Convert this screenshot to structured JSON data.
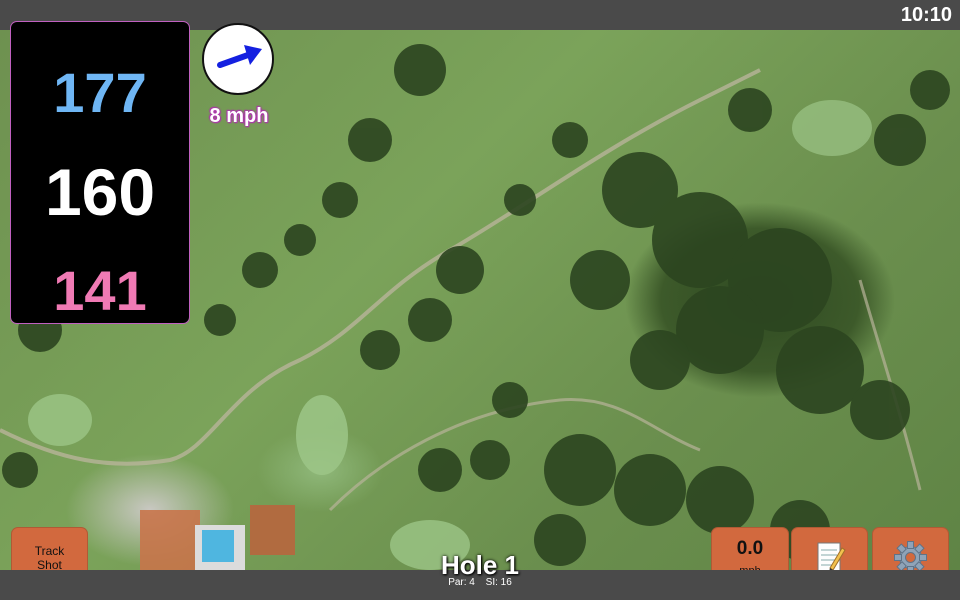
{
  "status": {
    "time": "10:10"
  },
  "distances": {
    "back": "177",
    "middle": "160",
    "front": "141",
    "back_color": "#6fb6f4",
    "front_color": "#f07ab4"
  },
  "wind": {
    "speed": "8 mph",
    "arrow_icon": "wind-direction-arrow-icon",
    "arrow_color": "#1420e0"
  },
  "buttons": {
    "track_shot_line1": "Track",
    "track_shot_line2": "Shot",
    "speed_value": "0.0",
    "speed_unit": "mph",
    "notes_icon": "notepad-icon",
    "settings_icon": "gear-icon",
    "button_color": "#d2693e"
  },
  "hole": {
    "title": "Hole 1",
    "par": "Par: 4",
    "si": "SI: 16"
  }
}
